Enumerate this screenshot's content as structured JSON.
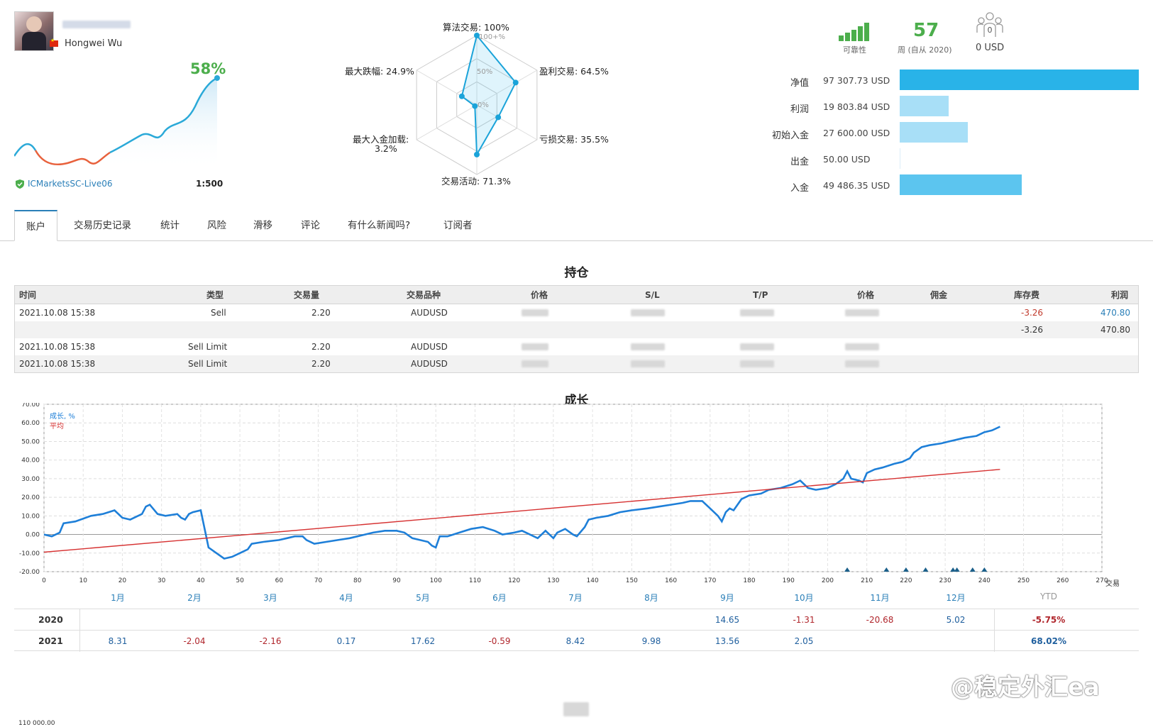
{
  "profile": {
    "name": "Hongwei Wu",
    "growth": "58%",
    "broker": "ICMarketsSC-Live06",
    "leverage": "1:500"
  },
  "radar": {
    "labels": {
      "algo": "算法交易: 100%",
      "profit_trades": "盈利交易: 64.5%",
      "loss_trades": "亏损交易: 35.5%",
      "activity": "交易活动: 71.3%",
      "max_deposit_load_line1": "最大入金加载:",
      "max_deposit_load_line2": "3.2%",
      "max_drawdown": "最大跌幅: 24.9%"
    },
    "scale": {
      "outer": "100+%",
      "mid": "50%",
      "center": "0%"
    },
    "values": [
      100,
      64.5,
      35.5,
      71.3,
      3.2,
      24.9
    ]
  },
  "summary": {
    "reliability_label": "可靠性",
    "weeks_value": "57",
    "weeks_label": "周 (自从 2020)",
    "subscribers_count": "0",
    "subscribers_value": "0 USD",
    "stats": [
      {
        "label": "净值",
        "value": "97 307.73 USD",
        "fraction": 1.0,
        "color": "#29b3e8"
      },
      {
        "label": "利润",
        "value": "19 803.84 USD",
        "fraction": 0.204,
        "color": "#a8dff7"
      },
      {
        "label": "初始入金",
        "value": "27 600.00 USD",
        "fraction": 0.284,
        "color": "#a8dff7"
      },
      {
        "label": "出金",
        "value": "50.00 USD",
        "fraction": 0.002,
        "color": "#dceef8"
      },
      {
        "label": "入金",
        "value": "49 486.35 USD",
        "fraction": 0.509,
        "color": "#5cc5ef"
      }
    ]
  },
  "tabs": [
    "账户",
    "交易历史记录",
    "统计",
    "风险",
    "滑移",
    "评论",
    "有什么新闻吗?",
    "订阅者"
  ],
  "positions": {
    "title": "持仓",
    "headers": [
      "时间",
      "类型",
      "交易量",
      "交易品种",
      "价格",
      "S/L",
      "T/P",
      "价格",
      "佣金",
      "库存费",
      "利润"
    ],
    "rows": [
      {
        "time": "2021.10.08 15:38",
        "type": "Sell",
        "volume": "2.20",
        "symbol": "AUDUSD",
        "swap": "-3.26",
        "profit": "470.80"
      },
      {
        "time": "",
        "type": "",
        "volume": "",
        "symbol": "",
        "swap": "-3.26",
        "profit": "470.80"
      },
      {
        "time": "2021.10.08 15:38",
        "type": "Sell Limit",
        "volume": "2.20",
        "symbol": "AUDUSD",
        "swap": "",
        "profit": ""
      },
      {
        "time": "2021.10.08 15:38",
        "type": "Sell Limit",
        "volume": "2.20",
        "symbol": "AUDUSD",
        "swap": "",
        "profit": ""
      }
    ]
  },
  "growth": {
    "title": "成长",
    "legend_growth": "成长, %",
    "legend_avg": "平均",
    "x_axis_label": "交易"
  },
  "chart_data": {
    "type": "line",
    "title": "成长",
    "xlabel": "交易",
    "ylabel": "",
    "xlim": [
      0,
      270
    ],
    "ylim": [
      -20,
      70
    ],
    "x_ticks": [
      0,
      10,
      20,
      30,
      40,
      50,
      60,
      70,
      80,
      90,
      100,
      110,
      120,
      130,
      140,
      150,
      160,
      170,
      180,
      190,
      200,
      210,
      220,
      230,
      240,
      250,
      260,
      270
    ],
    "y_ticks": [
      "70.00",
      "60.00",
      "50.00",
      "40.00",
      "30.00",
      "20.00",
      "10.00",
      "0.00",
      "-10.00",
      "-20.00"
    ],
    "series": [
      {
        "name": "成长, %",
        "color": "#1e7fd8",
        "points": [
          [
            0,
            0
          ],
          [
            2,
            -1
          ],
          [
            4,
            1
          ],
          [
            5,
            6
          ],
          [
            8,
            7
          ],
          [
            12,
            10
          ],
          [
            15,
            11
          ],
          [
            18,
            13
          ],
          [
            20,
            9
          ],
          [
            22,
            8
          ],
          [
            25,
            11
          ],
          [
            26,
            15
          ],
          [
            27,
            16
          ],
          [
            29,
            11
          ],
          [
            31,
            10
          ],
          [
            34,
            11
          ],
          [
            35,
            9
          ],
          [
            36,
            8
          ],
          [
            37,
            11
          ],
          [
            38,
            12
          ],
          [
            40,
            13
          ],
          [
            41,
            3
          ],
          [
            42,
            -7
          ],
          [
            44,
            -10
          ],
          [
            46,
            -13
          ],
          [
            48,
            -12
          ],
          [
            50,
            -10
          ],
          [
            52,
            -8
          ],
          [
            53,
            -5
          ],
          [
            56,
            -4
          ],
          [
            60,
            -3
          ],
          [
            62,
            -2
          ],
          [
            64,
            -1
          ],
          [
            66,
            -1
          ],
          [
            67,
            -3
          ],
          [
            69,
            -5
          ],
          [
            72,
            -4
          ],
          [
            75,
            -3
          ],
          [
            78,
            -2
          ],
          [
            80,
            -1
          ],
          [
            84,
            1
          ],
          [
            87,
            2
          ],
          [
            90,
            2
          ],
          [
            92,
            1
          ],
          [
            94,
            -2
          ],
          [
            96,
            -3
          ],
          [
            98,
            -4
          ],
          [
            99,
            -6
          ],
          [
            100,
            -7
          ],
          [
            101,
            -1
          ],
          [
            103,
            -1
          ],
          [
            106,
            1
          ],
          [
            109,
            3
          ],
          [
            112,
            4
          ],
          [
            115,
            2
          ],
          [
            116,
            1
          ],
          [
            117,
            0
          ],
          [
            120,
            1
          ],
          [
            122,
            2
          ],
          [
            124,
            0
          ],
          [
            125,
            -1
          ],
          [
            126,
            -2
          ],
          [
            128,
            2
          ],
          [
            129,
            0
          ],
          [
            130,
            -2
          ],
          [
            131,
            1
          ],
          [
            133,
            3
          ],
          [
            135,
            0
          ],
          [
            136,
            -1
          ],
          [
            138,
            4
          ],
          [
            139,
            8
          ],
          [
            141,
            9
          ],
          [
            144,
            10
          ],
          [
            147,
            12
          ],
          [
            150,
            13
          ],
          [
            154,
            14
          ],
          [
            157,
            15
          ],
          [
            160,
            16
          ],
          [
            163,
            17
          ],
          [
            165,
            18
          ],
          [
            168,
            18
          ],
          [
            170,
            14
          ],
          [
            172,
            10
          ],
          [
            173,
            7
          ],
          [
            174,
            12
          ],
          [
            175,
            14
          ],
          [
            176,
            13
          ],
          [
            178,
            19
          ],
          [
            180,
            21
          ],
          [
            183,
            22
          ],
          [
            185,
            24
          ],
          [
            188,
            25
          ],
          [
            191,
            27
          ],
          [
            193,
            29
          ],
          [
            195,
            25
          ],
          [
            197,
            24
          ],
          [
            200,
            25
          ],
          [
            202,
            27
          ],
          [
            204,
            30
          ],
          [
            205,
            34
          ],
          [
            206,
            30
          ],
          [
            208,
            29
          ],
          [
            209,
            28
          ],
          [
            210,
            33
          ],
          [
            212,
            35
          ],
          [
            214,
            36
          ],
          [
            217,
            38
          ],
          [
            219,
            39
          ],
          [
            221,
            41
          ],
          [
            222,
            44
          ],
          [
            224,
            47
          ],
          [
            226,
            48
          ],
          [
            229,
            49
          ],
          [
            231,
            50
          ],
          [
            233,
            51
          ],
          [
            235,
            52
          ],
          [
            238,
            53
          ],
          [
            240,
            55
          ],
          [
            242,
            56
          ],
          [
            244,
            58
          ]
        ]
      },
      {
        "name": "平均",
        "color": "#d63232",
        "points": [
          [
            0,
            -9.5
          ],
          [
            244,
            35
          ]
        ]
      }
    ],
    "markers_x": [
      205,
      215,
      220,
      225,
      232,
      233,
      237,
      240
    ]
  },
  "monthly": {
    "months": [
      "1月",
      "2月",
      "3月",
      "4月",
      "5月",
      "6月",
      "7月",
      "8月",
      "9月",
      "10月",
      "11月",
      "12月",
      "YTD"
    ],
    "rows": [
      {
        "year": "2020",
        "values": [
          "",
          "",
          "",
          "",
          "",
          "",
          "",
          "",
          "14.65",
          "-1.31",
          "-20.68",
          "5.02",
          "-5.75%"
        ]
      },
      {
        "year": "2021",
        "values": [
          "8.31",
          "-2.04",
          "-2.16",
          "0.17",
          "17.62",
          "-0.59",
          "8.42",
          "9.98",
          "13.56",
          "2.05",
          "",
          "",
          "68.02%"
        ]
      }
    ]
  },
  "watermark": "@稳定外汇ea",
  "bottom_axis_label": "110 000.00"
}
